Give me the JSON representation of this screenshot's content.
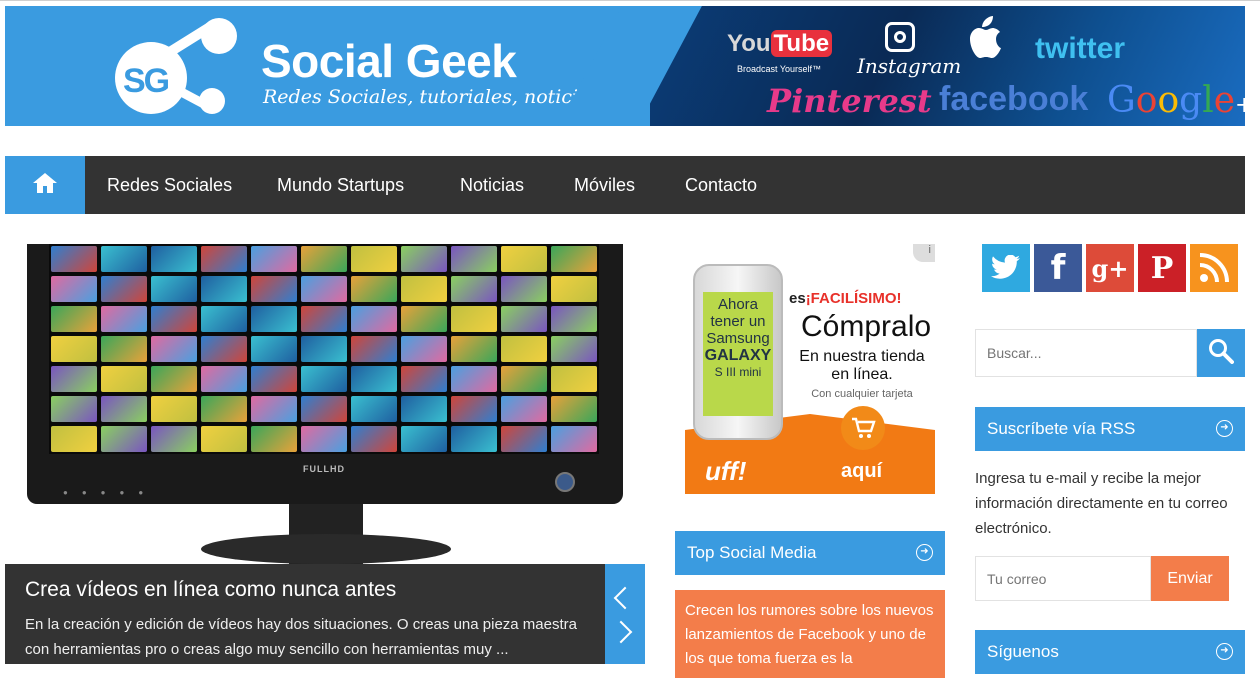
{
  "header": {
    "logo_initials": "SG",
    "site_name": "Social Geek",
    "tagline": "Redes Sociales, tutoriales, noticias",
    "brands": {
      "youtube_you": "You",
      "youtube_tube": "Tube",
      "youtube_sub": "Broadcast Yourself™",
      "instagram": "Instagram",
      "twitter": "twitter",
      "pinterest": "Pinterest",
      "facebook": "facebook",
      "google": [
        "G",
        "o",
        "o",
        "g",
        "l",
        "e",
        "+"
      ]
    }
  },
  "nav": {
    "home_icon": "home-icon",
    "items": [
      "Redes Sociales",
      "Mundo Startups",
      "Noticias",
      "Móviles",
      "Contacto"
    ]
  },
  "slider": {
    "monitor_brand": "FULLHD",
    "title": "Crea vídeos en línea como nunca antes",
    "excerpt": "En la creación y edición de vídeos hay dos situaciones. O creas una pieza maestra con herramientas pro o creas algo muy sencillo con herramientas muy ...",
    "prev_icon": "chevron-left-icon",
    "next_icon": "chevron-right-icon"
  },
  "ad": {
    "info": "i",
    "phone_line1": "Ahora",
    "phone_line2": "tener un",
    "phone_line3": "Samsung",
    "phone_line4": "GALAXY",
    "phone_line5": "S III mini",
    "head_prefix": "es",
    "head_highlight": "¡FACILÍSIMO!",
    "big": "Cómpralo",
    "sub": "En nuestra tienda en línea.",
    "small": "Con cualquier tarjeta",
    "brand": "uff!",
    "cta": "aquí"
  },
  "middle": {
    "top_social_title": "Top Social Media",
    "news_text": "Crecen los rumores sobre los nuevos lanzamientos de Facebook y uno de los que toma fuerza es la"
  },
  "sidebar": {
    "social_icons": [
      "twitter-icon",
      "facebook-icon",
      "google-plus-icon",
      "pinterest-icon",
      "rss-icon"
    ],
    "facebook_glyph": "f",
    "gplus_glyph": "g+",
    "pinterest_glyph": "P",
    "search_placeholder": "Buscar...",
    "rss_title": "Suscríbete vía RSS",
    "rss_text": "Ingresa tu e-mail y recibe la mejor información directamente en tu correo electrónico.",
    "email_placeholder": "Tu correo",
    "email_button": "Enviar",
    "follow_title": "Síguenos"
  },
  "colors": {
    "accent_blue": "#3a9be0",
    "nav_dark": "#333333",
    "accent_orange": "#f37d4a"
  }
}
